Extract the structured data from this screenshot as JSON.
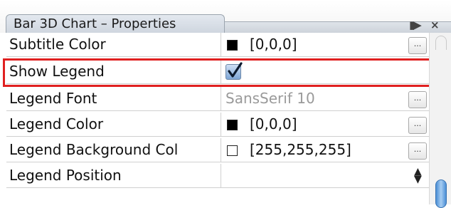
{
  "window": {
    "title": "Bar 3D Chart – Properties",
    "maximize_label": "▮▶",
    "close_label": "×"
  },
  "properties": [
    {
      "name": "Subtitle Color",
      "value": "[0,0,0]",
      "swatch": "#000000",
      "has_button": true,
      "button_label": "..."
    },
    {
      "name": "Show Legend",
      "checked": true
    },
    {
      "name": "Legend Font",
      "value": "SansSerif 10",
      "has_button": true,
      "button_label": "..."
    },
    {
      "name": "Legend Color",
      "value": "[0,0,0]",
      "swatch": "#000000",
      "has_button": true,
      "button_label": "..."
    },
    {
      "name": "Legend Background Col",
      "value": "[255,255,255]",
      "swatch": "#ffffff",
      "has_button": true,
      "button_label": "..."
    },
    {
      "name": "Legend Position",
      "value": "",
      "spinner": "▲▼"
    }
  ],
  "colors": {
    "highlight": "#e02020",
    "checkbox_blue": "#7ea6d6",
    "scroll_thumb": "#4b8fd6"
  }
}
